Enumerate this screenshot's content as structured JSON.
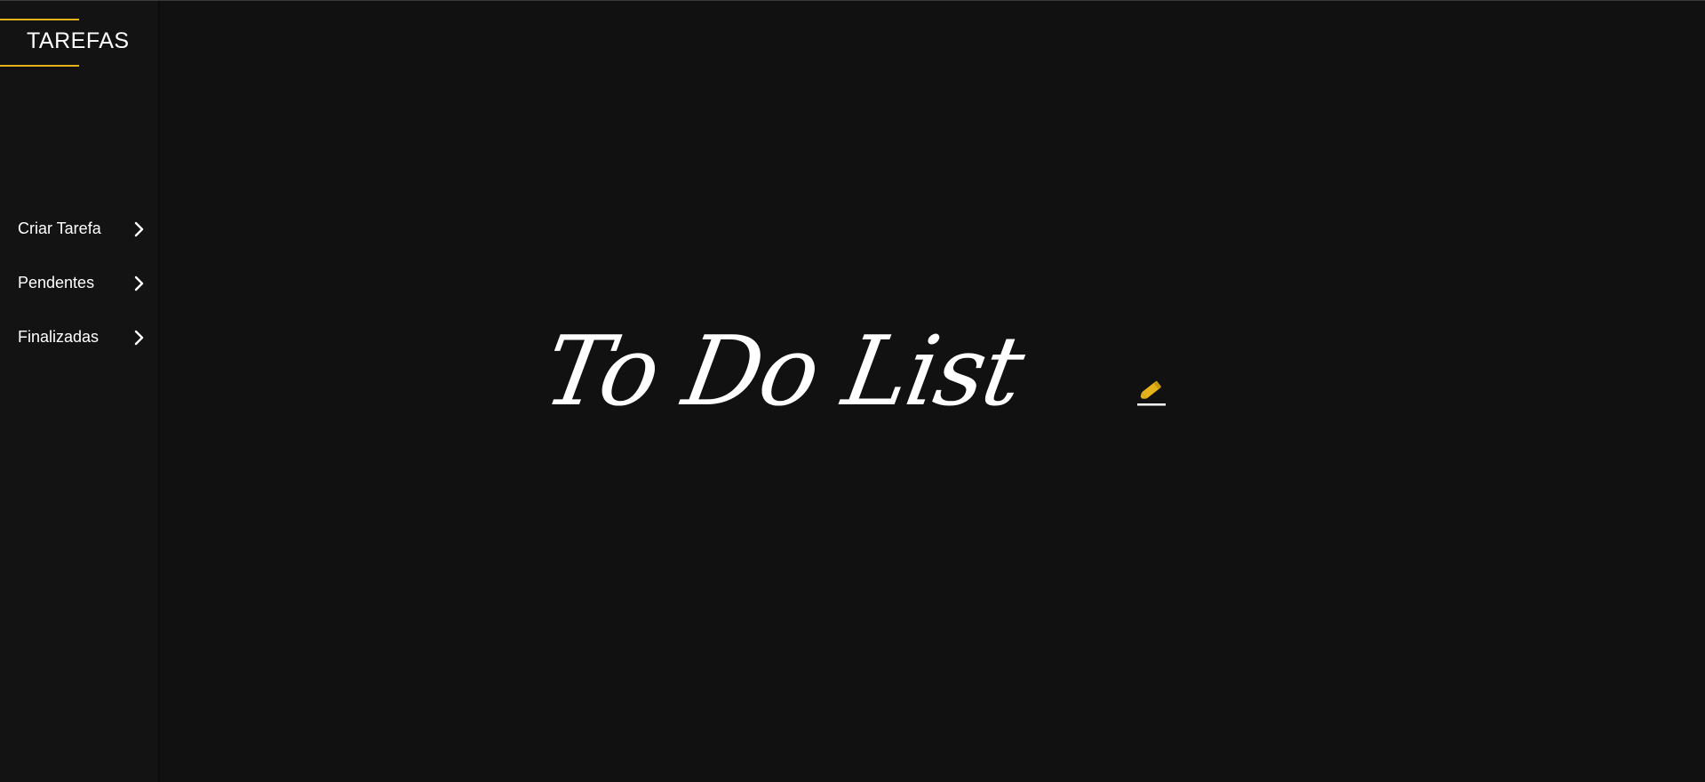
{
  "sidebar": {
    "brand": "TAREFAS",
    "items": [
      {
        "label": "Criar Tarefa",
        "icon": "chevron-right-icon"
      },
      {
        "label": "Pendentes",
        "icon": "chevron-right-icon"
      },
      {
        "label": "Finalizadas",
        "icon": "chevron-right-icon"
      }
    ]
  },
  "main": {
    "title": "To Do List",
    "title_icon": "pencil-icon"
  },
  "colors": {
    "background": "#111111",
    "sidebar": "#131313",
    "accent": "#E5B319",
    "text": "#FFFFFF"
  }
}
